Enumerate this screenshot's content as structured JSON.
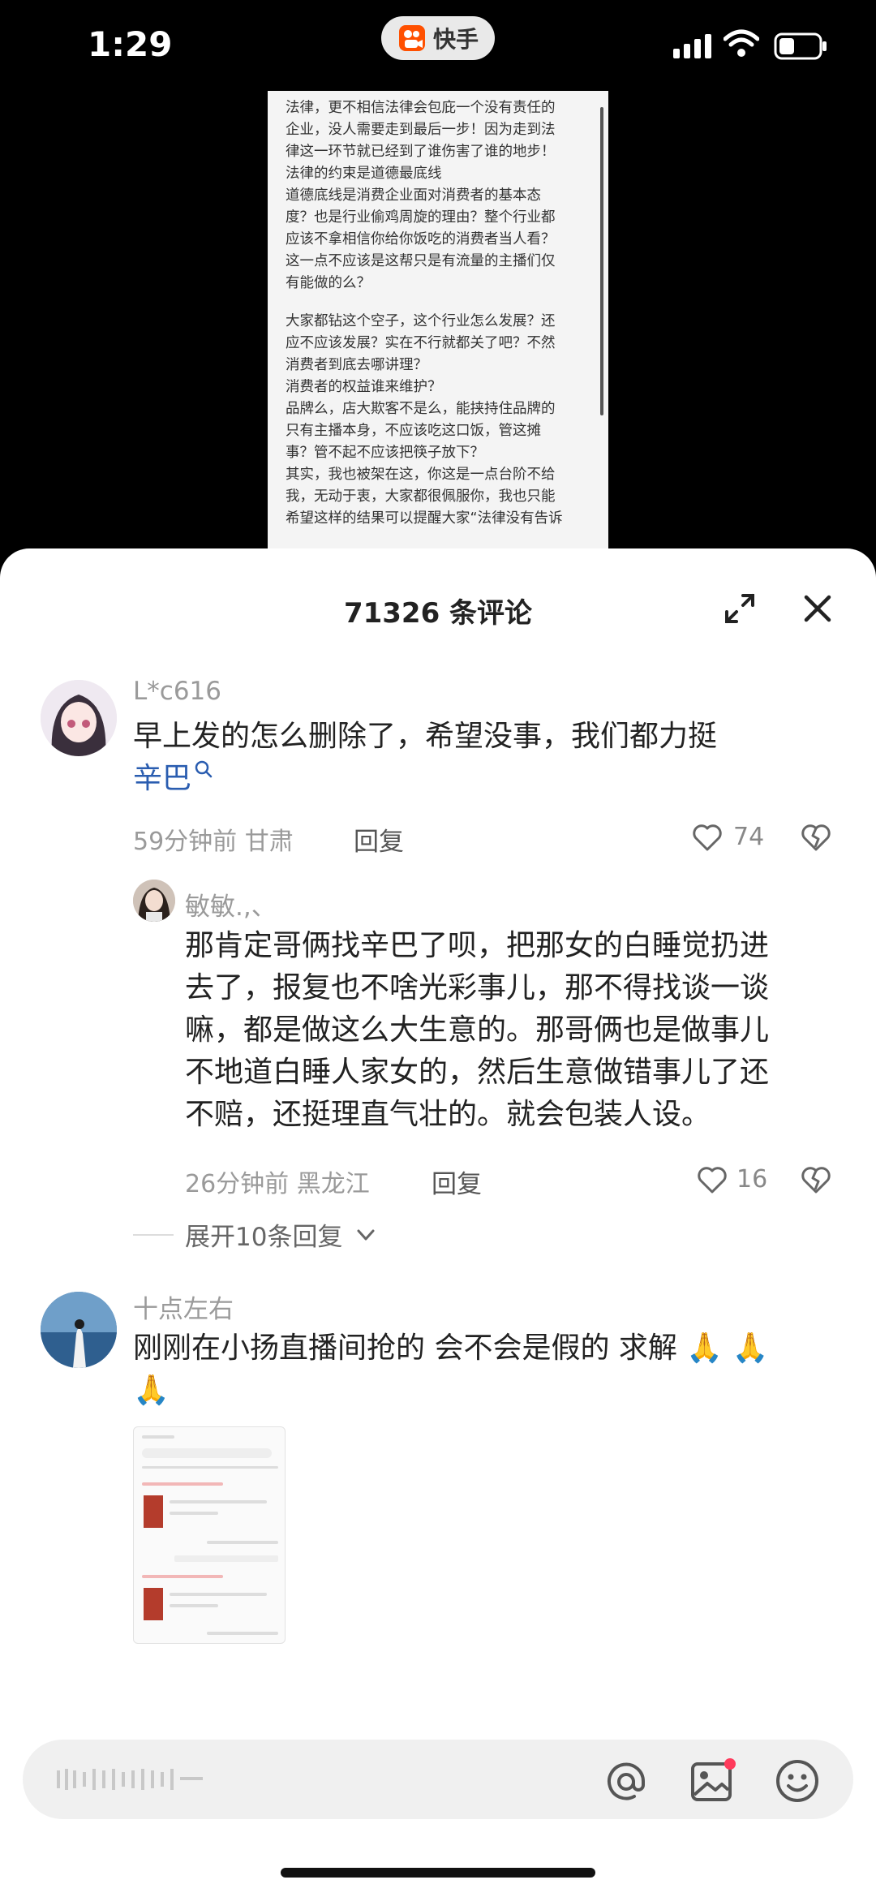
{
  "status_bar": {
    "time": "1:29",
    "app_name": "快手"
  },
  "video": {
    "doc_lines": [
      "法律，更不相信法律会包庇一个没有责任的",
      "企业，没人需要走到最后一步！因为走到法",
      "律这一环节就已经到了谁伤害了谁的地步！",
      "法律的约束是道德最底线",
      "道德底线是消费企业面对消费者的基本态",
      "度？也是行业偷鸡周旋的理由？整个行业都",
      "应该不拿相信你给你饭吃的消费者当人看？",
      "这一点不应该是这帮只是有流量的主播们仅",
      "有能做的么？",
      "",
      "大家都钻这个空子，这个行业怎么发展？还",
      "应不应该发展？实在不行就都关了吧？不然",
      "消费者到底去哪讲理？",
      "消费者的权益谁来维护？",
      "品牌么，店大欺客不是么，能挟持住品牌的",
      "只有主播本身，不应该吃这口饭，管这摊",
      "事？管不起不应该把筷子放下？",
      "其实，我也被架在这，你这是一点台阶不给",
      "我，无动于衷，大家都很佩服你，我也只能",
      "希望这样的结果可以提醒大家“法律没有告诉"
    ]
  },
  "sheet": {
    "title": "71326 条评论"
  },
  "comments": [
    {
      "username": "L*c616",
      "text": "早上发的怎么删除了，希望没事，我们都力挺",
      "link": "辛巴",
      "meta": "59分钟前 甘肃",
      "reply_label": "回复",
      "likes": "74"
    },
    {
      "username": "敏敏.,、",
      "lines": [
        "那肯定哥俩找辛巴了呗，把那女的白睡觉扔进",
        "去了，报复也不啥光彩事儿，那不得找谈一谈",
        "嘛，都是做这么大生意的。那哥俩也是做事儿",
        "不地道白睡人家女的，然后生意做错事儿了还",
        "不赔，还挺理直气壮的。就会包装人设。"
      ],
      "meta": "26分钟前 黑龙江",
      "reply_label": "回复",
      "likes": "16"
    },
    {
      "username": "十点左右",
      "text": "刚刚在小扬直播间抢的 会不会是假的 求解 🙏 🙏",
      "text2": "🙏"
    }
  ],
  "expand_replies": {
    "label": "展开10条回复"
  },
  "input": {
    "placeholder": ""
  },
  "colors": {
    "link": "#2a5db0",
    "notification_dot": "#ff3b5c",
    "brand": "#ff5000"
  }
}
